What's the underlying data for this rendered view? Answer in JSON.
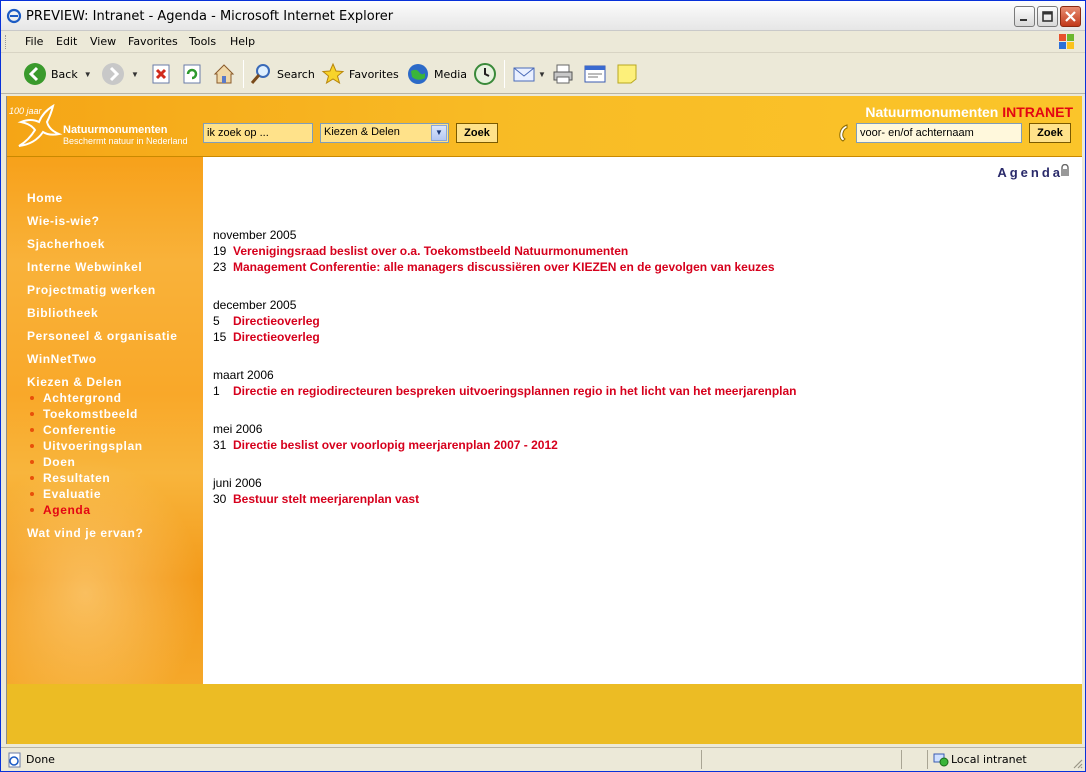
{
  "window": {
    "title": "PREVIEW: Intranet - Agenda - Microsoft Internet Explorer"
  },
  "menubar": {
    "items": [
      "File",
      "Edit",
      "View",
      "Favorites",
      "Tools",
      "Help"
    ]
  },
  "toolbar": {
    "back_label": "Back",
    "search_label": "Search",
    "favorites_label": "Favorites",
    "media_label": "Media"
  },
  "header": {
    "logo_line0": "100 jaar",
    "logo_line1": "Natuurmonumenten",
    "logo_line2": "Beschermt natuur in Nederland",
    "search_value": "ik zoek op ...",
    "category_value": "Kiezen & Delen",
    "search_button": "Zoek",
    "brand_name": "Natuurmonumenten",
    "brand_suffix": "INTRANET",
    "name_search_value": "voor- en/of achternaam",
    "name_search_button": "Zoek"
  },
  "sidebar": {
    "items": [
      {
        "label": "Home"
      },
      {
        "label": "Wie-is-wie?"
      },
      {
        "label": "Sjacherhoek"
      },
      {
        "label": "Interne Webwinkel"
      },
      {
        "label": "Projectmatig werken"
      },
      {
        "label": "Bibliotheek"
      },
      {
        "label": "Personeel & organisatie"
      },
      {
        "label": "WinNetTwo"
      },
      {
        "label": "Kiezen & Delen"
      }
    ],
    "subitems": [
      {
        "label": "Achtergrond"
      },
      {
        "label": "Toekomstbeeld"
      },
      {
        "label": "Conferentie"
      },
      {
        "label": "Uitvoeringsplan"
      },
      {
        "label": "Doen"
      },
      {
        "label": "Resultaten"
      },
      {
        "label": "Evaluatie"
      },
      {
        "label": "Agenda"
      }
    ],
    "last_item": "Wat vind je ervan?"
  },
  "content": {
    "page_title": "Agenda",
    "months": [
      {
        "label": "november 2005",
        "events": [
          {
            "day": "19",
            "title": "Verenigingsraad beslist over o.a. Toekomstbeeld Natuurmonumenten"
          },
          {
            "day": "23",
            "title": "Management Conferentie: alle managers discussiëren over KIEZEN en de gevolgen van keuzes"
          }
        ]
      },
      {
        "label": "december 2005",
        "events": [
          {
            "day": "5",
            "title": "Directieoverleg"
          },
          {
            "day": "15",
            "title": "Directieoverleg"
          }
        ]
      },
      {
        "label": "maart 2006",
        "events": [
          {
            "day": "1",
            "title": "Directie en regiodirecteuren bespreken uitvoeringsplannen regio in het licht van het meerjarenplan"
          }
        ]
      },
      {
        "label": "mei 2006",
        "events": [
          {
            "day": "31",
            "title": "Directie beslist over voorlopig meerjarenplan 2007 - 2012"
          }
        ]
      },
      {
        "label": "juni 2006",
        "events": [
          {
            "day": "30",
            "title": "Bestuur stelt meerjarenplan vast"
          }
        ]
      }
    ]
  },
  "statusbar": {
    "status": "Done",
    "zone": "Local intranet"
  }
}
